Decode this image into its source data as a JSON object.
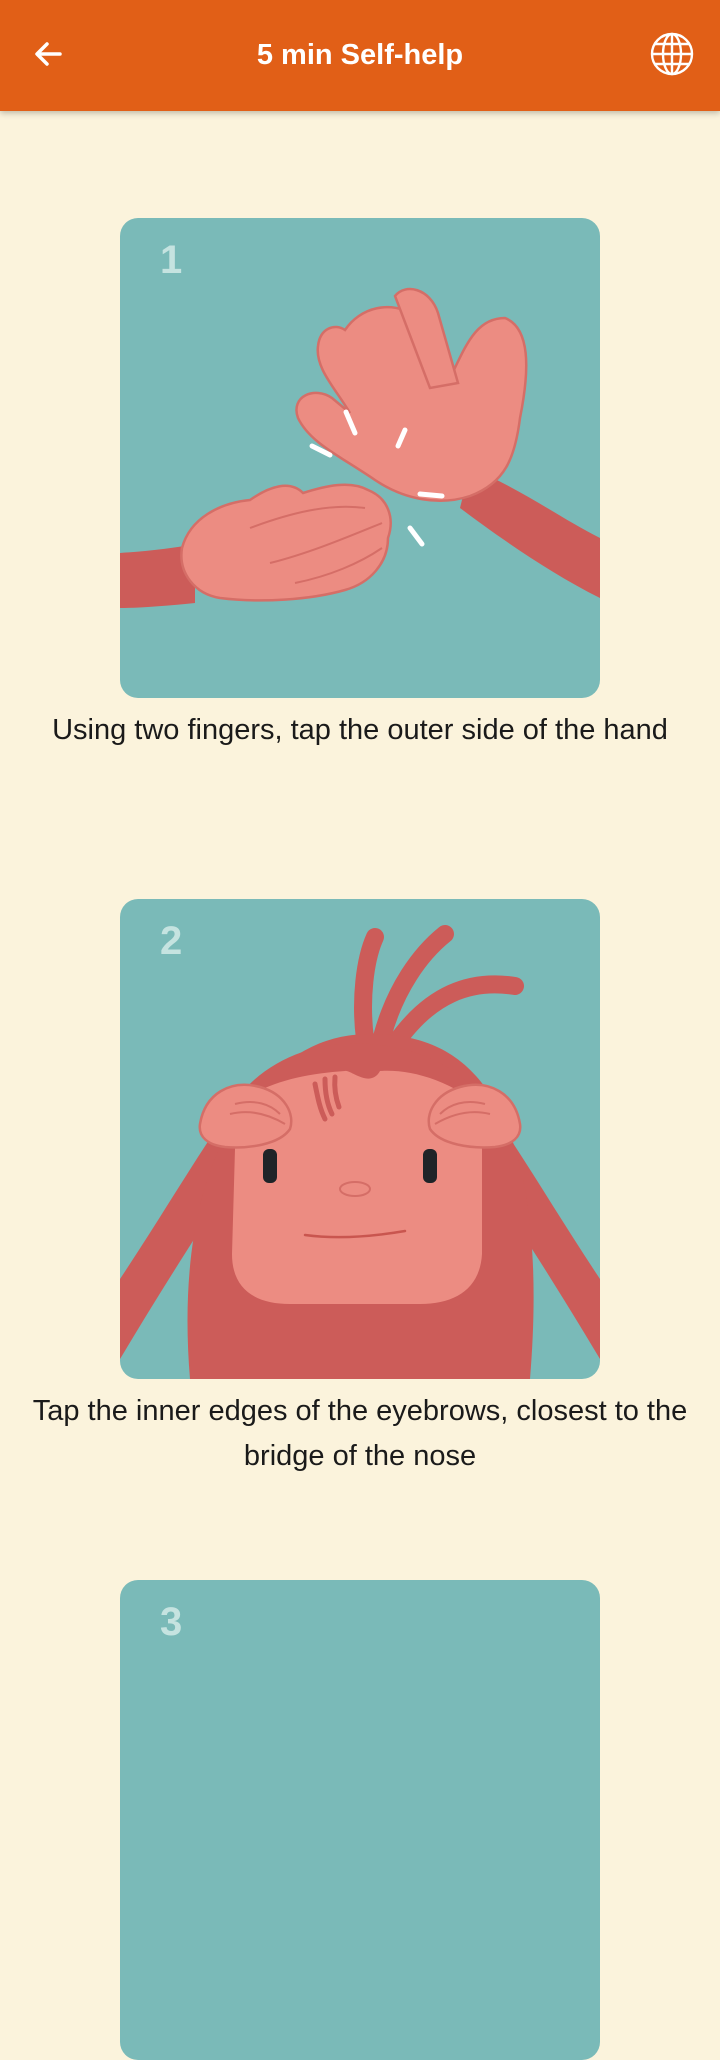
{
  "header": {
    "title": "5 min Self-help",
    "back_icon": "arrow-left-icon",
    "language_icon": "globe-icon",
    "background_color": "#E15F17"
  },
  "steps": [
    {
      "number": "1",
      "caption": "Using two fingers, tap the outer side of the hand"
    },
    {
      "number": "2",
      "caption": "Tap the inner edges of the eyebrows, closest to the bridge of the nose"
    },
    {
      "number": "3"
    }
  ],
  "colors": {
    "page_background": "#FBF3DC",
    "card_background": "#7ABAB8",
    "illustration_skin": "#EC8C82",
    "illustration_dark": "#CC5C59"
  }
}
